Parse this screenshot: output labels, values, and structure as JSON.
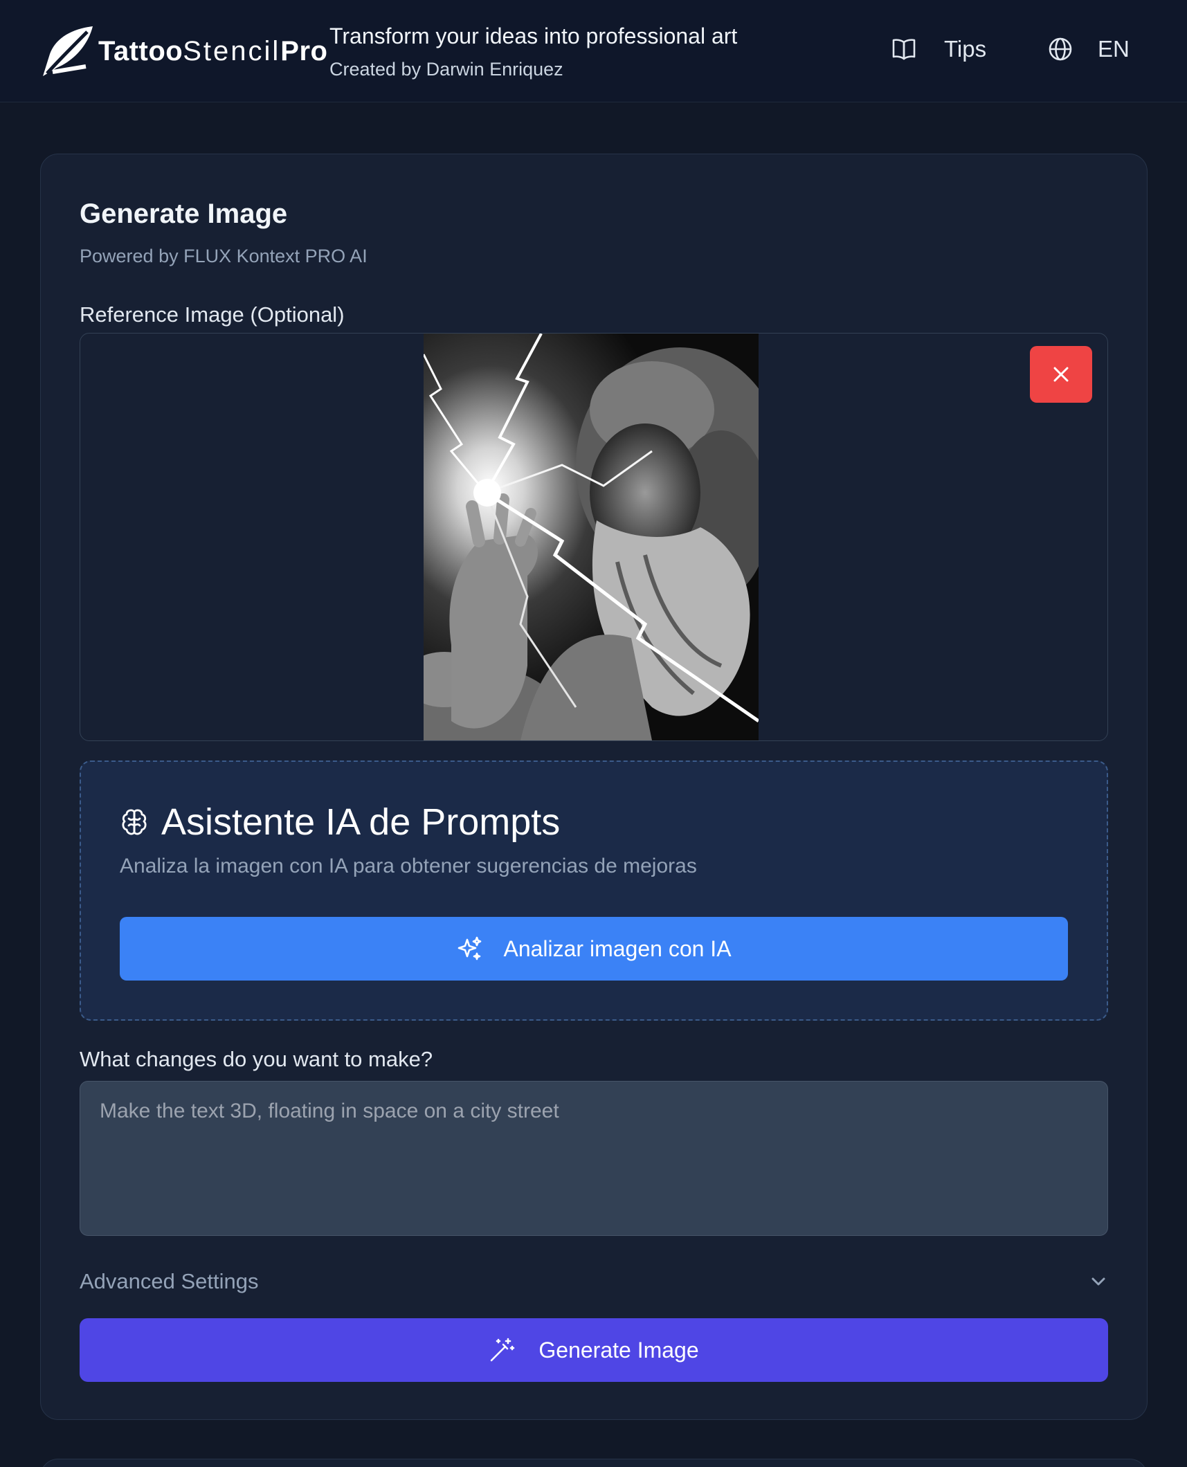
{
  "header": {
    "logo_part1": "Tattoo",
    "logo_part2": "Stencil",
    "logo_part3": "Pro",
    "tagline": "Transform your ideas into professional art",
    "credit": "Created by Darwin Enriquez",
    "tips_label": "Tips",
    "language_label": "EN",
    "tips_icon": "book-open-icon",
    "language_icon": "globe-icon"
  },
  "generator": {
    "title": "Generate Image",
    "subtitle": "Powered by FLUX Kontext PRO AI",
    "reference_label": "Reference Image (Optional)",
    "remove_icon": "close-icon"
  },
  "assistant": {
    "title": "Asistente IA de Prompts",
    "description": "Analiza la imagen con IA para obtener sugerencias de mejoras",
    "analyze_label": "Analizar imagen con IA",
    "icon": "brain-icon",
    "analyze_icon": "sparkles-icon"
  },
  "prompt": {
    "label": "What changes do you want to make?",
    "placeholder": "Make the text 3D, floating in space on a city street",
    "value": ""
  },
  "advanced": {
    "label": "Advanced Settings",
    "icon": "chevron-down-icon"
  },
  "generate": {
    "label": "Generate Image",
    "icon": "magic-wand-icon"
  },
  "colors": {
    "page_bg": "#111827",
    "card_bg": "#172033",
    "accent_blue": "#3b82f6",
    "accent_indigo": "#4f46e5",
    "danger": "#ef4444"
  }
}
